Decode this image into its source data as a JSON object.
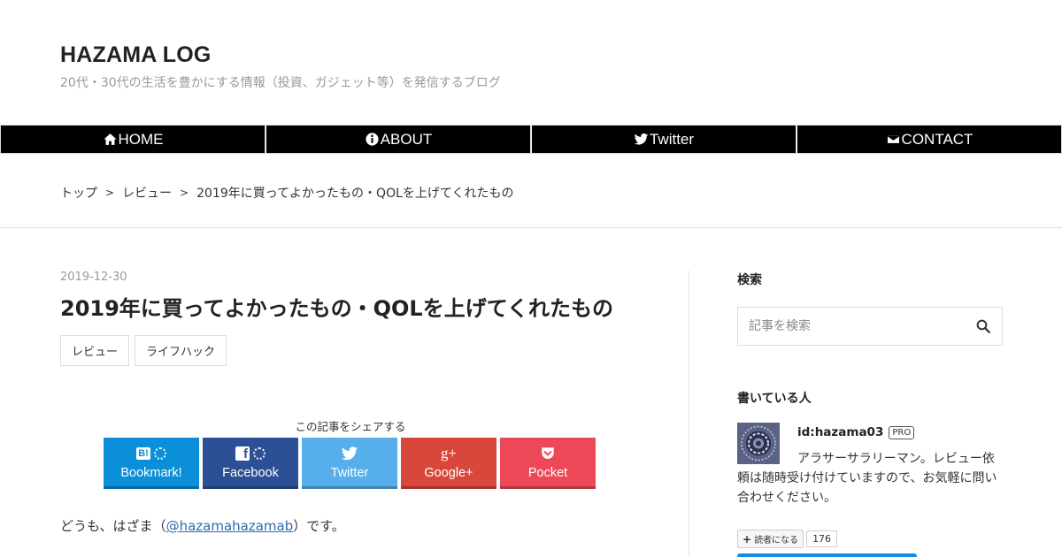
{
  "site": {
    "title": "HAZAMA LOG",
    "description": "20代・30代の生活を豊かにする情報（投資、ガジェット等）を発信するブログ"
  },
  "nav": {
    "items": [
      {
        "label": "HOME",
        "icon": "home-icon"
      },
      {
        "label": "ABOUT",
        "icon": "info-circle-icon"
      },
      {
        "label": "Twitter",
        "icon": "twitter-icon"
      },
      {
        "label": "CONTACT",
        "icon": "envelope-icon"
      }
    ]
  },
  "breadcrumb": {
    "items": [
      "トップ",
      "レビュー",
      "2019年に買ってよかったもの・QOLを上げてくれたもの"
    ],
    "separator": ">"
  },
  "post": {
    "date": "2019-12-30",
    "title": "2019年に買ってよかったもの・QOLを上げてくれたもの",
    "categories": [
      "レビュー",
      "ライフハック"
    ],
    "share_caption": "この記事をシェアする",
    "share_buttons": [
      {
        "label": "Bookmark!",
        "icon": "hatena-bookmark-icon",
        "icon_text": "B!",
        "color": "#0a8fd8"
      },
      {
        "label": "Facebook",
        "icon": "facebook-icon",
        "icon_text": "f",
        "color": "#2d4f96"
      },
      {
        "label": "Twitter",
        "icon": "twitter-icon",
        "icon_text": "",
        "color": "#56aeeb"
      },
      {
        "label": "Google+",
        "icon": "google-plus-icon",
        "icon_text": "g+",
        "color": "#d9473b"
      },
      {
        "label": "Pocket",
        "icon": "pocket-icon",
        "icon_text": "",
        "color": "#ec4857"
      }
    ],
    "intro_before": "どうも、はざま（",
    "intro_link": "@hazamahazamab",
    "intro_after": "）です。"
  },
  "sidebar": {
    "search_title": "検索",
    "search_placeholder": "記事を検索",
    "author_title": "書いている人",
    "author_id": "id:hazama03",
    "pro_badge": "PRO",
    "author_desc": "アラサーサラリーマン。レビュー依頼は随時受け付けていますので、お気軽に問い合わせください。",
    "reader_button": "読者になる",
    "reader_count": "176"
  }
}
